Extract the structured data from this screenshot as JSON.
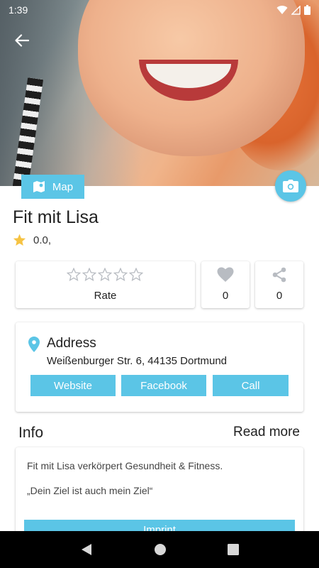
{
  "status_bar": {
    "time": "1:39"
  },
  "hero": {
    "description_icon": "profile-photo"
  },
  "map_button": {
    "label": "Map"
  },
  "business": {
    "name": "Fit mit Lisa",
    "rating_text": "0.0,"
  },
  "rate_card": {
    "label": "Rate",
    "stars": 5
  },
  "like_card": {
    "count": "0"
  },
  "share_card": {
    "count": "0"
  },
  "address_card": {
    "heading": "Address",
    "address": "Weißenburger Str. 6, 44135  Dortmund",
    "buttons": {
      "website": "Website",
      "facebook": "Facebook",
      "call": "Call"
    }
  },
  "info": {
    "heading": "Info",
    "read_more": "Read more",
    "line1": "Fit mit Lisa verkörpert Gesundheit & Fitness.",
    "line2": "„Dein Ziel ist auch mein Ziel“",
    "imprint_button": "Imprint"
  },
  "colors": {
    "accent": "#5bc5e6",
    "star": "#f6c343",
    "icon_grey": "#b8bcc2"
  }
}
